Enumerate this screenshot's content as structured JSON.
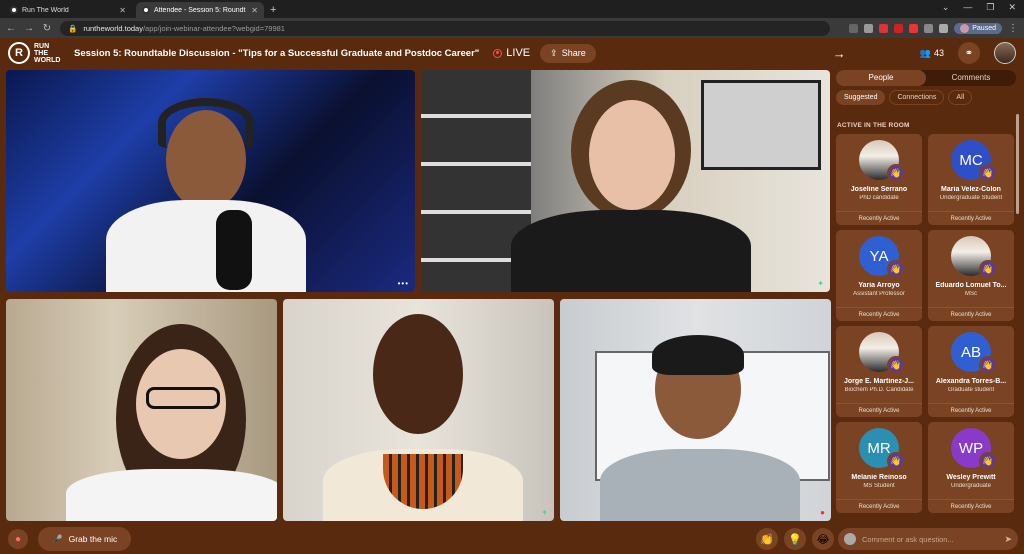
{
  "browser": {
    "tabs": [
      {
        "label": "Run The World",
        "active": false
      },
      {
        "label": "Attendee - Session 5: Roundt",
        "active": true
      }
    ],
    "url_domain": "runtheworld.today",
    "url_path": "/app/join-webinar-attendee?webgid=79981",
    "profile_status": "Paused"
  },
  "header": {
    "logo_mark": "R",
    "logo_text": "RUN THE WORLD",
    "session_title": "Session 5: Roundtable Discussion - \"Tips for a Successful Graduate and Postdoc Career\"",
    "live_label": "LIVE",
    "share_label": "Share",
    "attendee_count": "43"
  },
  "sidebar": {
    "tabs": [
      {
        "label": "People",
        "active": true
      },
      {
        "label": "Comments",
        "active": false
      }
    ],
    "filters": [
      {
        "label": "Suggested",
        "active": true
      },
      {
        "label": "Connections",
        "active": false
      },
      {
        "label": "All",
        "active": false
      }
    ],
    "section_label": "ACTIVE IN THE ROOM",
    "people": [
      {
        "initials": "",
        "name": "Joseline Serrano",
        "role": "PhD candidate",
        "status": "Recently Active",
        "color": "photo"
      },
      {
        "initials": "MC",
        "name": "Maria Velez-Colon",
        "role": "Undergraduate Student",
        "status": "Recently Active",
        "color": "#2f4fc8"
      },
      {
        "initials": "YA",
        "name": "Yaria Arroyo",
        "role": "Assistant Professor",
        "status": "Recently Active",
        "color": "#2f5fd0"
      },
      {
        "initials": "",
        "name": "Eduardo Lomuel To...",
        "role": "MSc",
        "status": "Recently Active",
        "color": "photo"
      },
      {
        "initials": "",
        "name": "Jorge E. Martinez-J...",
        "role": "Biochem Ph.D. Candidate",
        "status": "Recently Active",
        "color": "photo"
      },
      {
        "initials": "AB",
        "name": "Alexandra Torres-B...",
        "role": "Graduate student",
        "status": "Recently Active",
        "color": "#2f5fd0"
      },
      {
        "initials": "MR",
        "name": "Melanie Reinoso",
        "role": "MS Student",
        "status": "Recently Active",
        "color": "#2a8fb0"
      },
      {
        "initials": "WP",
        "name": "Wesley Prewitt",
        "role": "Undergraduate",
        "status": "Recently Active",
        "color": "#8a3ac8"
      }
    ]
  },
  "bottombar": {
    "grab_mic_label": "Grab the mic",
    "comment_placeholder": "Comment or ask question..."
  },
  "icons": {
    "logo": "run-the-world-logo",
    "live": "live-dot-icon",
    "share": "share-icon",
    "people": "people-icon",
    "wave": "wave-hand-icon"
  }
}
